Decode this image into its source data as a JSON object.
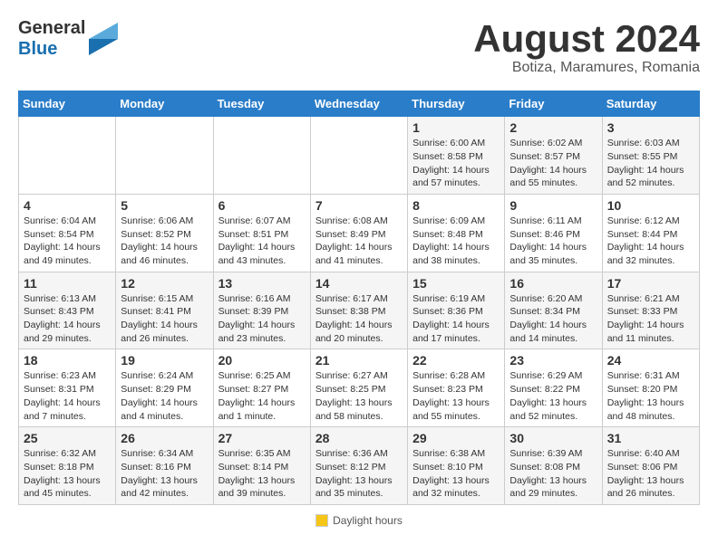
{
  "header": {
    "logo_line1": "General",
    "logo_line2": "Blue",
    "title": "August 2024",
    "subtitle": "Botiza, Maramures, Romania"
  },
  "columns": [
    "Sunday",
    "Monday",
    "Tuesday",
    "Wednesday",
    "Thursday",
    "Friday",
    "Saturday"
  ],
  "weeks": [
    [
      {
        "day": "",
        "info": ""
      },
      {
        "day": "",
        "info": ""
      },
      {
        "day": "",
        "info": ""
      },
      {
        "day": "",
        "info": ""
      },
      {
        "day": "1",
        "info": "Sunrise: 6:00 AM\nSunset: 8:58 PM\nDaylight: 14 hours and 57 minutes."
      },
      {
        "day": "2",
        "info": "Sunrise: 6:02 AM\nSunset: 8:57 PM\nDaylight: 14 hours and 55 minutes."
      },
      {
        "day": "3",
        "info": "Sunrise: 6:03 AM\nSunset: 8:55 PM\nDaylight: 14 hours and 52 minutes."
      }
    ],
    [
      {
        "day": "4",
        "info": "Sunrise: 6:04 AM\nSunset: 8:54 PM\nDaylight: 14 hours and 49 minutes."
      },
      {
        "day": "5",
        "info": "Sunrise: 6:06 AM\nSunset: 8:52 PM\nDaylight: 14 hours and 46 minutes."
      },
      {
        "day": "6",
        "info": "Sunrise: 6:07 AM\nSunset: 8:51 PM\nDaylight: 14 hours and 43 minutes."
      },
      {
        "day": "7",
        "info": "Sunrise: 6:08 AM\nSunset: 8:49 PM\nDaylight: 14 hours and 41 minutes."
      },
      {
        "day": "8",
        "info": "Sunrise: 6:09 AM\nSunset: 8:48 PM\nDaylight: 14 hours and 38 minutes."
      },
      {
        "day": "9",
        "info": "Sunrise: 6:11 AM\nSunset: 8:46 PM\nDaylight: 14 hours and 35 minutes."
      },
      {
        "day": "10",
        "info": "Sunrise: 6:12 AM\nSunset: 8:44 PM\nDaylight: 14 hours and 32 minutes."
      }
    ],
    [
      {
        "day": "11",
        "info": "Sunrise: 6:13 AM\nSunset: 8:43 PM\nDaylight: 14 hours and 29 minutes."
      },
      {
        "day": "12",
        "info": "Sunrise: 6:15 AM\nSunset: 8:41 PM\nDaylight: 14 hours and 26 minutes."
      },
      {
        "day": "13",
        "info": "Sunrise: 6:16 AM\nSunset: 8:39 PM\nDaylight: 14 hours and 23 minutes."
      },
      {
        "day": "14",
        "info": "Sunrise: 6:17 AM\nSunset: 8:38 PM\nDaylight: 14 hours and 20 minutes."
      },
      {
        "day": "15",
        "info": "Sunrise: 6:19 AM\nSunset: 8:36 PM\nDaylight: 14 hours and 17 minutes."
      },
      {
        "day": "16",
        "info": "Sunrise: 6:20 AM\nSunset: 8:34 PM\nDaylight: 14 hours and 14 minutes."
      },
      {
        "day": "17",
        "info": "Sunrise: 6:21 AM\nSunset: 8:33 PM\nDaylight: 14 hours and 11 minutes."
      }
    ],
    [
      {
        "day": "18",
        "info": "Sunrise: 6:23 AM\nSunset: 8:31 PM\nDaylight: 14 hours and 7 minutes."
      },
      {
        "day": "19",
        "info": "Sunrise: 6:24 AM\nSunset: 8:29 PM\nDaylight: 14 hours and 4 minutes."
      },
      {
        "day": "20",
        "info": "Sunrise: 6:25 AM\nSunset: 8:27 PM\nDaylight: 14 hours and 1 minute."
      },
      {
        "day": "21",
        "info": "Sunrise: 6:27 AM\nSunset: 8:25 PM\nDaylight: 13 hours and 58 minutes."
      },
      {
        "day": "22",
        "info": "Sunrise: 6:28 AM\nSunset: 8:23 PM\nDaylight: 13 hours and 55 minutes."
      },
      {
        "day": "23",
        "info": "Sunrise: 6:29 AM\nSunset: 8:22 PM\nDaylight: 13 hours and 52 minutes."
      },
      {
        "day": "24",
        "info": "Sunrise: 6:31 AM\nSunset: 8:20 PM\nDaylight: 13 hours and 48 minutes."
      }
    ],
    [
      {
        "day": "25",
        "info": "Sunrise: 6:32 AM\nSunset: 8:18 PM\nDaylight: 13 hours and 45 minutes."
      },
      {
        "day": "26",
        "info": "Sunrise: 6:34 AM\nSunset: 8:16 PM\nDaylight: 13 hours and 42 minutes."
      },
      {
        "day": "27",
        "info": "Sunrise: 6:35 AM\nSunset: 8:14 PM\nDaylight: 13 hours and 39 minutes."
      },
      {
        "day": "28",
        "info": "Sunrise: 6:36 AM\nSunset: 8:12 PM\nDaylight: 13 hours and 35 minutes."
      },
      {
        "day": "29",
        "info": "Sunrise: 6:38 AM\nSunset: 8:10 PM\nDaylight: 13 hours and 32 minutes."
      },
      {
        "day": "30",
        "info": "Sunrise: 6:39 AM\nSunset: 8:08 PM\nDaylight: 13 hours and 29 minutes."
      },
      {
        "day": "31",
        "info": "Sunrise: 6:40 AM\nSunset: 8:06 PM\nDaylight: 13 hours and 26 minutes."
      }
    ]
  ],
  "footer": {
    "legend_label": "Daylight hours"
  }
}
